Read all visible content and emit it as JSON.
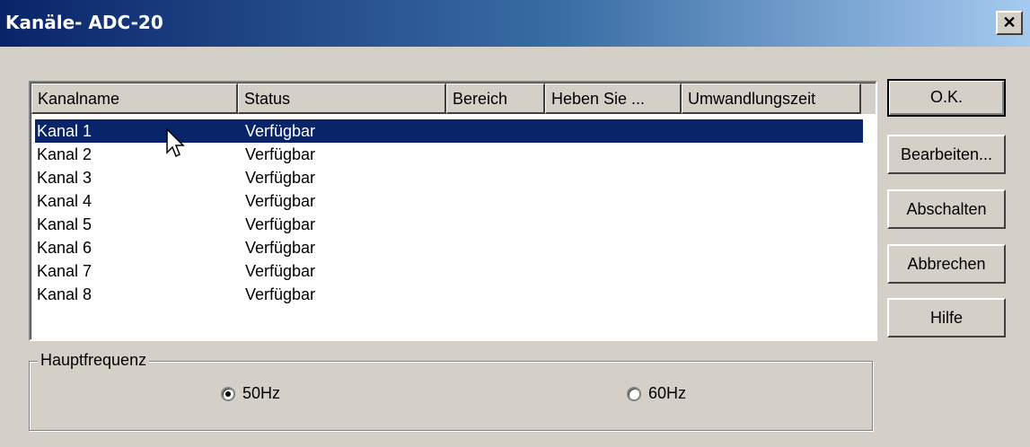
{
  "window": {
    "title": "Kanäle- ADC-20",
    "close_glyph": "✕"
  },
  "table": {
    "columns": [
      "Kanalname",
      "Status",
      "Bereich",
      "Heben Sie ...",
      "Umwandlungszeit"
    ],
    "rows": [
      {
        "name": "Kanal 1",
        "status": "Verfügbar",
        "selected": true
      },
      {
        "name": "Kanal 2",
        "status": "Verfügbar",
        "selected": false
      },
      {
        "name": "Kanal 3",
        "status": "Verfügbar",
        "selected": false
      },
      {
        "name": "Kanal 4",
        "status": "Verfügbar",
        "selected": false
      },
      {
        "name": "Kanal 5",
        "status": "Verfügbar",
        "selected": false
      },
      {
        "name": "Kanal 6",
        "status": "Verfügbar",
        "selected": false
      },
      {
        "name": "Kanal 7",
        "status": "Verfügbar",
        "selected": false
      },
      {
        "name": "Kanal 8",
        "status": "Verfügbar",
        "selected": false
      }
    ]
  },
  "buttons": {
    "ok": "O.K.",
    "edit": "Bearbeiten...",
    "disable": "Abschalten",
    "cancel": "Abbrechen",
    "help": "Hilfe"
  },
  "frequency": {
    "label": "Hauptfrequenz",
    "options": [
      {
        "label": "50Hz",
        "checked": true
      },
      {
        "label": "60Hz",
        "checked": false
      }
    ]
  },
  "colors": {
    "selection": "#0a246a",
    "dialog_bg": "#d4d0c8"
  }
}
